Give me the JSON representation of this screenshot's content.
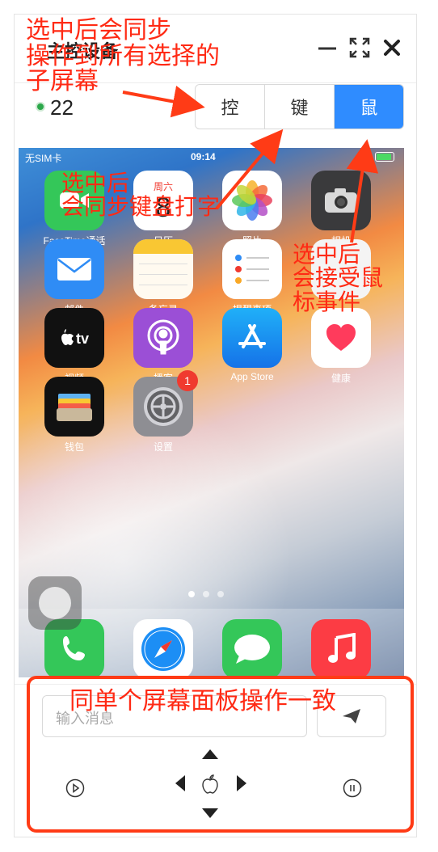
{
  "window": {
    "title": "主控设备",
    "min_icon": "minimize-icon",
    "max_icon": "fullscreen-icon",
    "close_icon": "close-icon"
  },
  "device_count": "22",
  "mode_tabs": [
    {
      "label": "控",
      "active": false
    },
    {
      "label": "键",
      "active": false
    },
    {
      "label": "鼠",
      "active": true
    }
  ],
  "phone": {
    "status": {
      "carrier": "无SIM卡",
      "time": "09:14"
    },
    "apps": [
      {
        "label": "FaceTime通话",
        "icon": "facetime-icon",
        "color": "#34c759"
      },
      {
        "label": "日历",
        "icon": "calendar-icon",
        "color": "#ffffff",
        "weekday": "周六",
        "day": "8"
      },
      {
        "label": "照片",
        "icon": "photos-icon",
        "color": "#ffffff"
      },
      {
        "label": "相机",
        "icon": "camera-icon",
        "color": "#3a3a3c"
      },
      {
        "label": "邮件",
        "icon": "mail-icon",
        "color": "#2f8cf5"
      },
      {
        "label": "备忘录",
        "icon": "notes-icon",
        "color": "#fff6d8"
      },
      {
        "label": "提醒事项",
        "icon": "reminders-icon",
        "color": "#ffffff"
      },
      {
        "label": "",
        "icon": "generic-app-icon",
        "color": "#f4f4f4"
      },
      {
        "label": "视频",
        "icon": "apple-tv-icon",
        "color": "#111111"
      },
      {
        "label": "播客",
        "icon": "podcasts-icon",
        "color": "#9b4fd6"
      },
      {
        "label": "App Store",
        "icon": "app-store-icon",
        "color": "#1c8ef5"
      },
      {
        "label": "健康",
        "icon": "health-icon",
        "color": "#ffffff"
      },
      {
        "label": "钱包",
        "icon": "wallet-icon",
        "color": "#111111"
      },
      {
        "label": "设置",
        "icon": "settings-icon",
        "color": "#8e8e93",
        "badge": "1"
      }
    ],
    "dock": [
      {
        "icon": "phone-icon",
        "color": "#34c759"
      },
      {
        "icon": "safari-icon",
        "color": "#ffffff"
      },
      {
        "icon": "messages-icon",
        "color": "#34c759"
      },
      {
        "icon": "music-icon",
        "color": "#fc3c44"
      }
    ]
  },
  "controls": {
    "input_placeholder": "输入消息",
    "send_icon": "send-icon",
    "play_icon": "play-icon",
    "pause_icon": "pause-icon",
    "up_icon": "arrow-up-icon",
    "down_icon": "arrow-down-icon",
    "left_icon": "arrow-left-icon",
    "right_icon": "arrow-right-icon",
    "home_icon": "apple-home-icon"
  },
  "annotations": {
    "sync_screens": "选中后会同步\n操作到所有选择的\n子屏幕",
    "sync_keyboard": "选中后\n会同步键盘打字",
    "mouse_events": "选中后\n会接受鼠\n标事件",
    "panel_same": "同单个屏幕面板操作一致",
    "color": "#ff2a14"
  }
}
